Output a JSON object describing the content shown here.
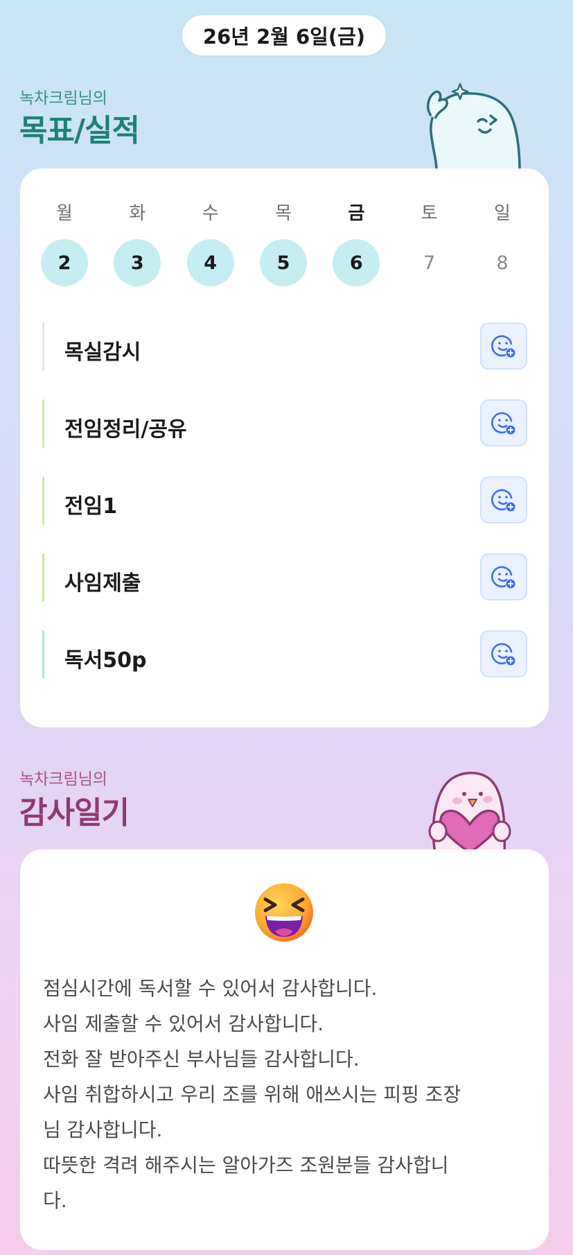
{
  "date": "26년 2월 6일(금)",
  "goals_section": {
    "subtitle": "녹차크림님의",
    "title": "목표/실적",
    "week": [
      {
        "label": "월",
        "num": "2",
        "status": "done"
      },
      {
        "label": "화",
        "num": "3",
        "status": "done"
      },
      {
        "label": "수",
        "num": "4",
        "status": "done"
      },
      {
        "label": "목",
        "num": "5",
        "status": "done"
      },
      {
        "label": "금",
        "num": "6",
        "status": "done",
        "today": true
      },
      {
        "label": "토",
        "num": "7",
        "status": "empty"
      },
      {
        "label": "일",
        "num": "8",
        "status": "empty"
      }
    ],
    "items": [
      {
        "label": "목실감시",
        "bar_color": "#e6e6e6",
        "icon": "smiley-add-icon"
      },
      {
        "label": "전임정리/공유",
        "bar_color": "#c9ec9a",
        "icon": "smiley-add-icon"
      },
      {
        "label": "전임1",
        "bar_color": "#c9ec9a",
        "icon": "smiley-add-icon"
      },
      {
        "label": "사임제출",
        "bar_color": "#c9ec9a",
        "icon": "smiley-add-icon"
      },
      {
        "label": "독서50p",
        "bar_color": "#a8ead6",
        "icon": "smiley-add-icon"
      }
    ]
  },
  "gratitude_section": {
    "subtitle": "녹차크림님의",
    "title": "감사일기",
    "mood_icon": "laughing-face-icon",
    "lines": [
      "점심시간에 독서할 수 있어서 감사합니다.",
      "사임 제출할 수 있어서 감사합니다.",
      "전화 잘 받아주신 부사님들 감사합니다.",
      "사임 취합하시고 우리 조를 위해 애쓰시는 피핑 조장",
      "님 감사합니다.",
      "따뜻한 격려 해주시는 알아가즈 조원분들 감사합니",
      "다."
    ]
  },
  "colors": {
    "accent_teal": "#1f7f79",
    "accent_plum": "#8e3a72",
    "done_circle": "#c6eef2",
    "icon_blue": "#3f6cf0"
  }
}
